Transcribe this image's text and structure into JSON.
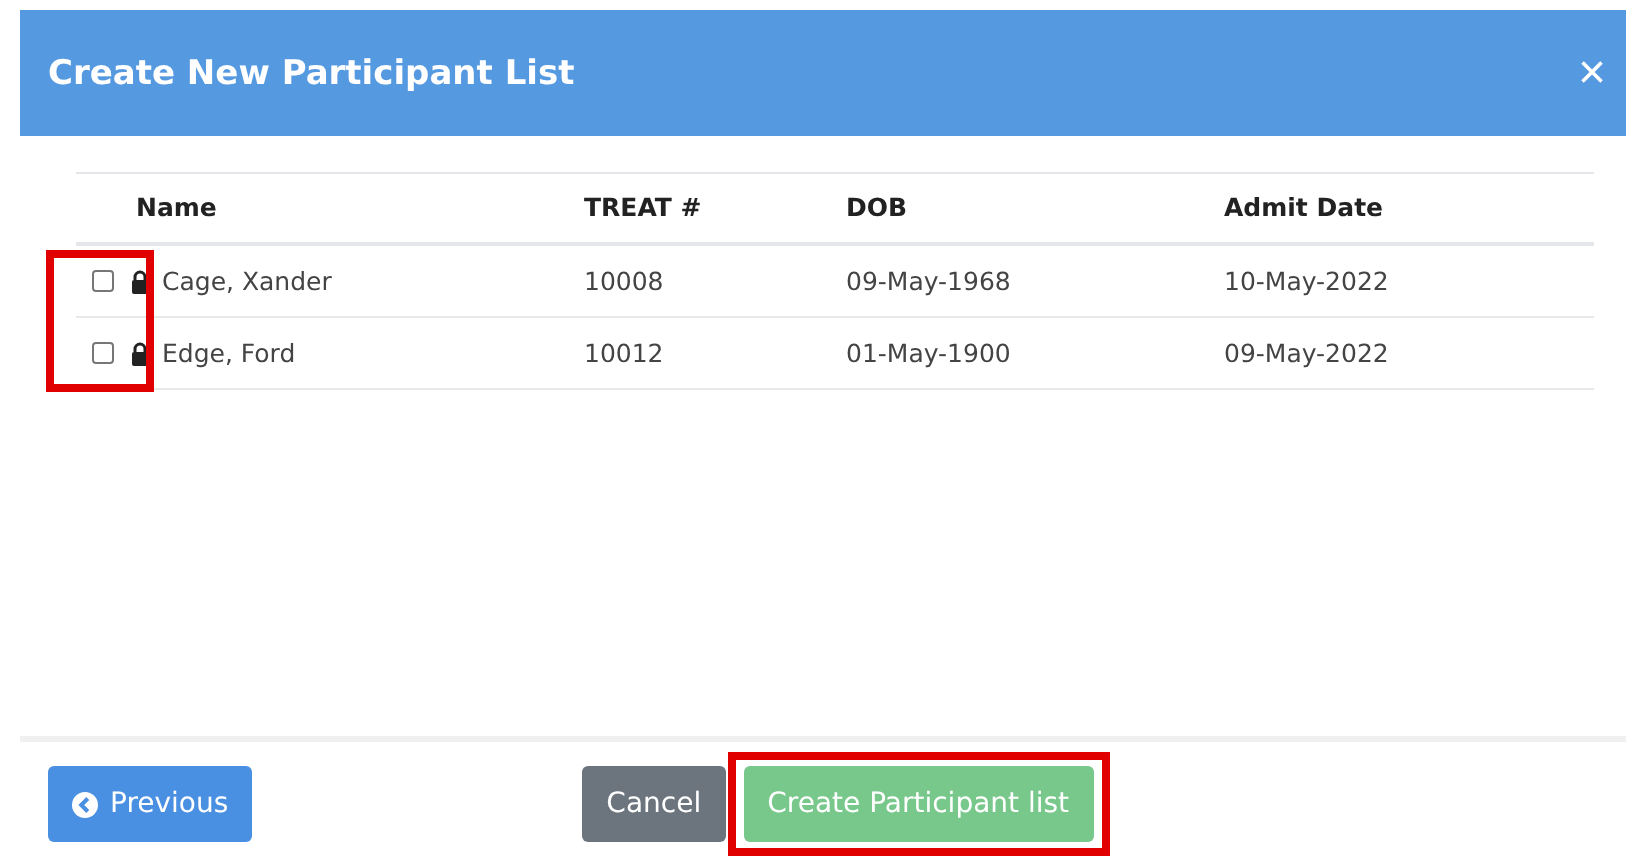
{
  "dialog": {
    "title": "Create New Participant List",
    "close": "×"
  },
  "table": {
    "columns": [
      "Name",
      "TREAT #",
      "DOB",
      "Admit Date"
    ],
    "checkbox_column_highlighted": true,
    "rows": [
      {
        "checked": false,
        "name": "Cage, Xander",
        "treat": "10008",
        "dob": "09-May-1968",
        "admit_date": "10-May-2022"
      },
      {
        "checked": false,
        "name": "Edge, Ford",
        "treat": "10012",
        "dob": "01-May-1900",
        "admit_date": "09-May-2022"
      }
    ]
  },
  "buttons": [
    {
      "kind": "previous",
      "label": "Previous",
      "highlighted": false
    },
    {
      "kind": "cancel",
      "label": "Cancel",
      "highlighted": false
    },
    {
      "kind": "create",
      "label": "Create Participant list",
      "highlighted": true
    }
  ]
}
